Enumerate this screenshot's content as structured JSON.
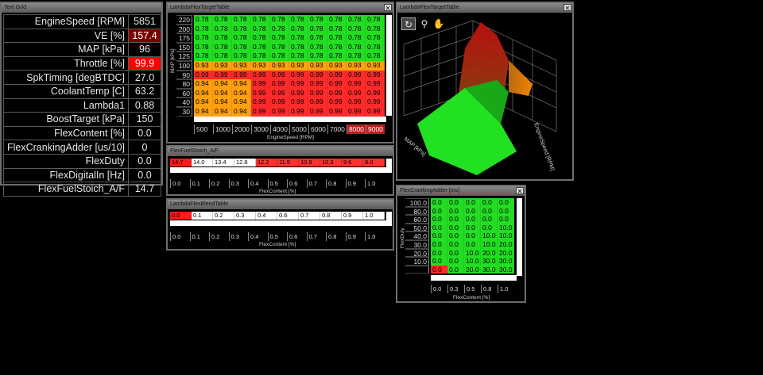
{
  "text_grid": {
    "title": "Text Grid",
    "rows": [
      {
        "label": "EngineSpeed [RPM]",
        "value": "5851",
        "style": ""
      },
      {
        "label": "VE [%]",
        "value": "157.4",
        "style": "darkred"
      },
      {
        "label": "MAP [kPa]",
        "value": "96",
        "style": ""
      },
      {
        "label": "Throttle [%]",
        "value": "99.9",
        "style": "red"
      },
      {
        "label": "SpkTiming [degBTDC]",
        "value": "27.0",
        "style": ""
      },
      {
        "label": "CoolantTemp [C]",
        "value": "63.2",
        "style": ""
      },
      {
        "label": "Lambda1",
        "value": "0.88",
        "style": ""
      },
      {
        "label": "BoostTarget [kPa]",
        "value": "150",
        "style": ""
      },
      {
        "label": "FlexContent [%]",
        "value": "0.0",
        "style": ""
      },
      {
        "label": "FlexCrankingAdder [us/10]",
        "value": "0",
        "style": ""
      },
      {
        "label": "FlexDuty",
        "value": "0.0",
        "style": ""
      },
      {
        "label": "FlexDigitalIn [Hz]",
        "value": "0.0",
        "style": ""
      },
      {
        "label": "FlexFuelStoich_A/F",
        "value": "14.7",
        "style": ""
      }
    ]
  },
  "lambda_table": {
    "title": "LambdaFlexTargetTable",
    "y_axis_label": "MAP [kPa]",
    "x_axis_label": "EngineSpeed [RPM]",
    "y_values": [
      "220",
      "200",
      "175",
      "150",
      "125",
      "100",
      "90",
      "80",
      "60",
      "40",
      "30"
    ],
    "x_values": [
      "500",
      "1000",
      "2000",
      "3000",
      "4000",
      "5000",
      "6000",
      "7000",
      "8000",
      "9000"
    ],
    "x_highlight": [
      8,
      9
    ],
    "rows": [
      [
        "0.78",
        "0.78",
        "0.78",
        "0.78",
        "0.78",
        "0.78",
        "0.78",
        "0.78",
        "0.78",
        "0.78"
      ],
      [
        "0.78",
        "0.78",
        "0.78",
        "0.78",
        "0.78",
        "0.78",
        "0.78",
        "0.78",
        "0.78",
        "0.78"
      ],
      [
        "0.78",
        "0.78",
        "0.78",
        "0.78",
        "0.78",
        "0.78",
        "0.78",
        "0.78",
        "0.78",
        "0.78"
      ],
      [
        "0.78",
        "0.78",
        "0.78",
        "0.78",
        "0.78",
        "0.78",
        "0.78",
        "0.78",
        "0.78",
        "0.78"
      ],
      [
        "0.78",
        "0.78",
        "0.78",
        "0.78",
        "0.78",
        "0.78",
        "0.78",
        "0.78",
        "0.78",
        "0.78"
      ],
      [
        "0.93",
        "0.93",
        "0.93",
        "0.93",
        "0.93",
        "0.93",
        "0.93",
        "0.93",
        "0.93",
        "0.93"
      ],
      [
        "0.99",
        "0.99",
        "0.99",
        "0.99",
        "0.99",
        "0.99",
        "0.99",
        "0.99",
        "0.99",
        "0.99"
      ],
      [
        "0.94",
        "0.94",
        "0.94",
        "0.99",
        "0.99",
        "0.99",
        "0.99",
        "0.99",
        "0.99",
        "0.99"
      ],
      [
        "0.94",
        "0.94",
        "0.94",
        "0.99",
        "0.99",
        "0.99",
        "0.99",
        "0.99",
        "0.99",
        "0.99"
      ],
      [
        "0.94",
        "0.94",
        "0.94",
        "0.99",
        "0.99",
        "0.99",
        "0.99",
        "0.99",
        "0.99",
        "0.99"
      ],
      [
        "0.94",
        "0.94",
        "0.94",
        "0.99",
        "0.99",
        "0.99",
        "0.99",
        "0.99",
        "0.99",
        "0.99"
      ]
    ],
    "colors": [
      [
        "g",
        "g",
        "g",
        "g",
        "g",
        "g",
        "g",
        "g",
        "g",
        "g"
      ],
      [
        "g",
        "g",
        "g",
        "g",
        "g",
        "g",
        "g",
        "g",
        "g",
        "g"
      ],
      [
        "g",
        "g",
        "g",
        "g",
        "g",
        "g",
        "g",
        "g",
        "g",
        "g"
      ],
      [
        "g",
        "g",
        "g",
        "g",
        "g",
        "g",
        "g",
        "g",
        "g",
        "g"
      ],
      [
        "g",
        "g",
        "g",
        "g",
        "g",
        "g",
        "g",
        "g",
        "g",
        "g"
      ],
      [
        "o",
        "o",
        "o",
        "o",
        "o",
        "o",
        "o",
        "o",
        "o",
        "o"
      ],
      [
        "r",
        "r",
        "r",
        "r",
        "r",
        "r",
        "r",
        "r",
        "r",
        "r"
      ],
      [
        "o",
        "o",
        "o",
        "r",
        "r",
        "r",
        "r",
        "r",
        "r",
        "r"
      ],
      [
        "o",
        "o",
        "o",
        "r",
        "r",
        "r",
        "r",
        "r",
        "r",
        "r"
      ],
      [
        "o",
        "o",
        "o",
        "r",
        "r",
        "r",
        "r",
        "r",
        "r",
        "r"
      ],
      [
        "o",
        "o",
        "o",
        "r",
        "r",
        "r",
        "r",
        "r",
        "r",
        "r"
      ]
    ]
  },
  "stoich": {
    "title": "FlexFuelStoich_A/F",
    "values": [
      "14.7",
      "14.0",
      "13.4",
      "12.8",
      "12.2",
      "11.5",
      "10.9",
      "10.3",
      "9.6",
      "9.0"
    ],
    "colors": [
      "r",
      "w",
      "w",
      "w",
      "r2",
      "r2",
      "r2",
      "r2",
      "r2",
      "r2"
    ],
    "axis": [
      "0.0",
      "0.1",
      "0.2",
      "0.3",
      "0.4",
      "0.5",
      "0.6",
      "0.7",
      "0.8",
      "0.9",
      "1.0"
    ],
    "axis_label": "FlexContent [%]"
  },
  "blend": {
    "title": "LambdaFlexBlendTable",
    "values": [
      "0.0",
      "0.1",
      "0.2",
      "0.3",
      "0.4",
      "0.6",
      "0.7",
      "0.8",
      "0.9",
      "1.0"
    ],
    "colors": [
      "r",
      "w",
      "w",
      "w",
      "w",
      "w",
      "w",
      "w",
      "w",
      "w"
    ],
    "axis": [
      "0.0",
      "0.1",
      "0.2",
      "0.3",
      "0.4",
      "0.5",
      "0.6",
      "0.7",
      "0.8",
      "0.9",
      "1.0"
    ],
    "axis_label": "FlexContent [%]"
  },
  "surface": {
    "title": "LambdaFlexTargetTable",
    "axis_labels": [
      "MAP [kPa]",
      "EngineSpeed [RPM]"
    ],
    "tick_labels": [
      "300",
      "200",
      "100",
      "200",
      "300"
    ],
    "tools": [
      "rotate-icon",
      "zoom-icon",
      "pan-icon"
    ]
  },
  "cranking": {
    "title": "FlexCrankingAdder [ms]",
    "y_axis_label": "FlexDuty",
    "x_axis_label": "FlexContent [%]",
    "y_values": [
      "100.0",
      "80.0",
      "60.0",
      "50.0",
      "40.0",
      "30.0",
      "20.0",
      "10.0"
    ],
    "x_values": [
      "0.0",
      "0.3",
      "0.5",
      "0.8",
      "1.0"
    ],
    "rows": [
      [
        "0.0",
        "0.0",
        "0.0",
        "0.0",
        "0.0"
      ],
      [
        "0.0",
        "0.0",
        "0.0",
        "0.0",
        "0.0"
      ],
      [
        "0.0",
        "0.0",
        "0.0",
        "0.0",
        "0.0"
      ],
      [
        "0.0",
        "0.0",
        "0.0",
        "0.0",
        "10.0"
      ],
      [
        "0.0",
        "0.0",
        "0.0",
        "10.0",
        "10.0"
      ],
      [
        "0.0",
        "0.0",
        "0.0",
        "10.0",
        "20.0"
      ],
      [
        "0.0",
        "0.0",
        "10.0",
        "20.0",
        "20.0"
      ],
      [
        "0.0",
        "0.0",
        "10.0",
        "30.0",
        "30.0"
      ],
      [
        "0.0",
        "0.0",
        "20.0",
        "30.0",
        "30.0"
      ]
    ],
    "colors": [
      [
        "g",
        "g",
        "g",
        "g",
        "g"
      ],
      [
        "g",
        "g",
        "g",
        "g",
        "g"
      ],
      [
        "g",
        "g",
        "g",
        "g",
        "g"
      ],
      [
        "g",
        "g",
        "g",
        "g",
        "g"
      ],
      [
        "g",
        "g",
        "g",
        "g",
        "g"
      ],
      [
        "g",
        "g",
        "g",
        "g",
        "g"
      ],
      [
        "g",
        "g",
        "g",
        "g",
        "g"
      ],
      [
        "g",
        "g",
        "g",
        "g",
        "g"
      ],
      [
        "r",
        "g",
        "g",
        "g",
        "g"
      ]
    ],
    "y_values_full": [
      "100.0",
      "80.0",
      "60.0",
      "50.0",
      "40.0",
      "30.0",
      "20.0",
      "10.0",
      ""
    ]
  },
  "colors": {
    "green": "#22dd22",
    "orange": "#ffa010",
    "red": "#ff2a2a",
    "highlight": "#b82020"
  }
}
